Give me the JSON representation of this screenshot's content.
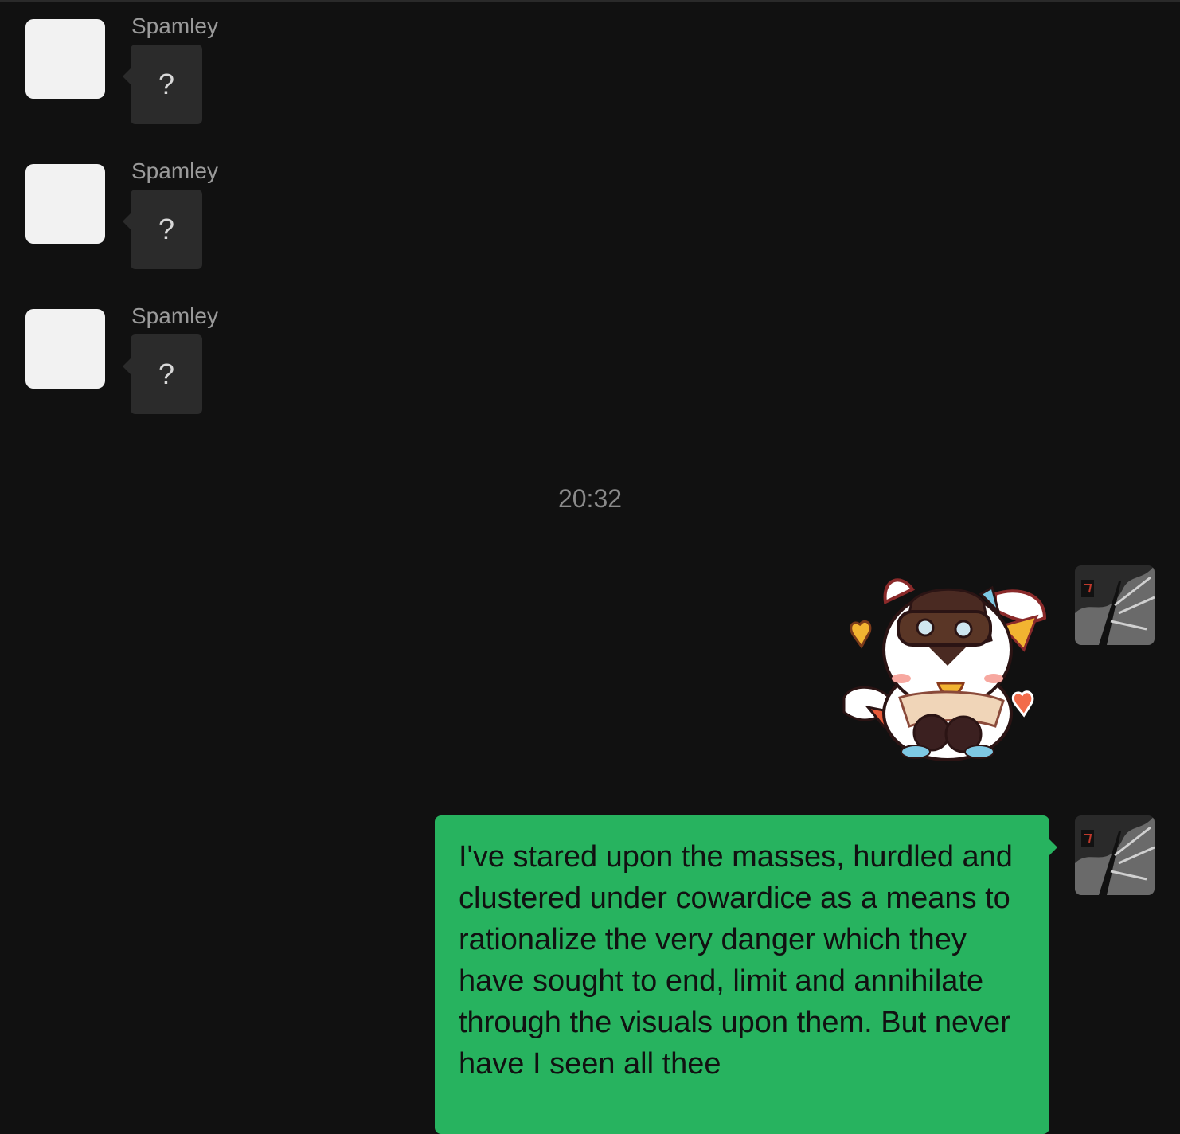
{
  "chat": {
    "incoming": [
      {
        "sender": "Spamley",
        "text": "?"
      },
      {
        "sender": "Spamley",
        "text": "?"
      },
      {
        "sender": "Spamley",
        "text": "?"
      }
    ],
    "timestamp": "20:32",
    "outgoing_text": "I've stared upon the masses, hurdled and clustered under cowardice as a means to rationalize the very danger which they have sought to end, limit and annihilate through the visuals upon them. But never have I seen all thee"
  },
  "colors": {
    "background": "#111111",
    "incoming_bubble": "#2b2b2b",
    "outgoing_bubble": "#27b35f"
  }
}
